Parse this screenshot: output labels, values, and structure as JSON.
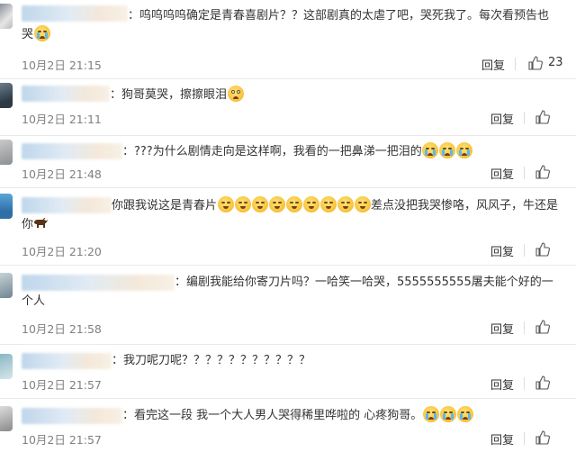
{
  "comments": [
    {
      "text": "：呜呜呜呜确定是青春喜剧片？？这部剧真的太虐了吧，哭死我了。每次看预告也哭",
      "emojis": [
        "crying-emoji"
      ],
      "date": "10月2日 21:15",
      "reply_label": "回复",
      "like_count": "23"
    },
    {
      "text": "：狗哥莫哭，擦擦眼泪",
      "emojis": [
        "pleading-emoji"
      ],
      "date": "10月2日 21:11",
      "reply_label": "回复",
      "like_count": ""
    },
    {
      "text": "：???为什么剧情走向是这样啊，我看的一把鼻涕一把泪的",
      "emojis": [
        "crying-emoji",
        "crying-emoji",
        "crying-emoji"
      ],
      "date": "10月2日 21:48",
      "reply_label": "回复",
      "like_count": ""
    },
    {
      "text_a": "你跟我说这是青春片",
      "text_b": "差点没把我哭惨咯，风风子，牛还是你",
      "emojis": [
        "smirk-emoji",
        "smirk-emoji",
        "smirk-emoji",
        "smirk-emoji",
        "smirk-emoji",
        "smirk-emoji",
        "smirk-emoji",
        "smirk-emoji",
        "smirk-emoji"
      ],
      "trailing_icon": "bull-icon",
      "date": "10月2日 21:20",
      "reply_label": "回复",
      "like_count": ""
    },
    {
      "text": "：编剧我能给你寄刀片吗？一哈笑一哈哭，5555555555屠夫能个好的一个人",
      "date": "10月2日 21:58",
      "reply_label": "回复",
      "like_count": ""
    },
    {
      "text": "：我刀呢刀呢？？？？？？？？？？？",
      "date": "10月2日 21:57",
      "reply_label": "回复",
      "like_count": ""
    },
    {
      "text": "：看完这一段 我一个大人男人哭得稀里哗啦的 心疼狗哥。",
      "emojis": [
        "crying-emoji",
        "crying-emoji",
        "crying-emoji"
      ],
      "date": "10月2日 21:57",
      "reply_label": "回复",
      "like_count": ""
    }
  ]
}
